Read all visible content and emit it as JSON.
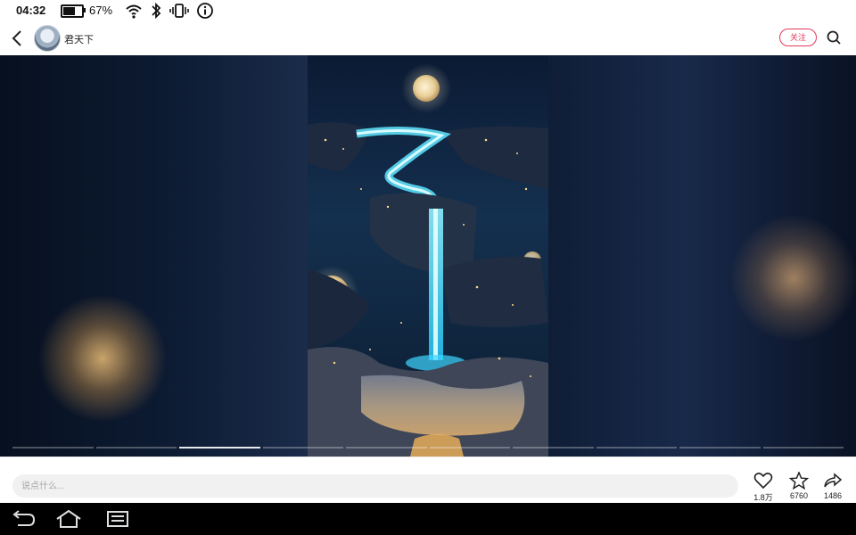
{
  "status_bar": {
    "time": "04:32",
    "battery_percent": "67%",
    "battery_level": 0.67,
    "icons": [
      "battery-icon",
      "wifi-icon",
      "bluetooth-icon",
      "vibrate-icon",
      "info-icon"
    ]
  },
  "header": {
    "author_name": "君天下",
    "follow_label": "关注",
    "icons": [
      "back-arrow-icon",
      "avatar",
      "search-icon"
    ]
  },
  "media": {
    "slide_count": 10,
    "active_slide_index": 2,
    "subject": "waterfall under moonlight artwork"
  },
  "comment": {
    "placeholder": "说点什么..."
  },
  "actions": {
    "like_count": "1.8万",
    "favorite_count": "6760",
    "share_count": "1486",
    "icons": [
      "heart-icon",
      "star-icon",
      "share-icon"
    ]
  },
  "nav_bar": {
    "icons": [
      "back-nav-icon",
      "home-nav-icon",
      "recents-nav-icon"
    ]
  },
  "colors": {
    "accent": "#e03b5b",
    "nav_background": "#000000",
    "waterfall_glow": "#3fd6ff"
  }
}
